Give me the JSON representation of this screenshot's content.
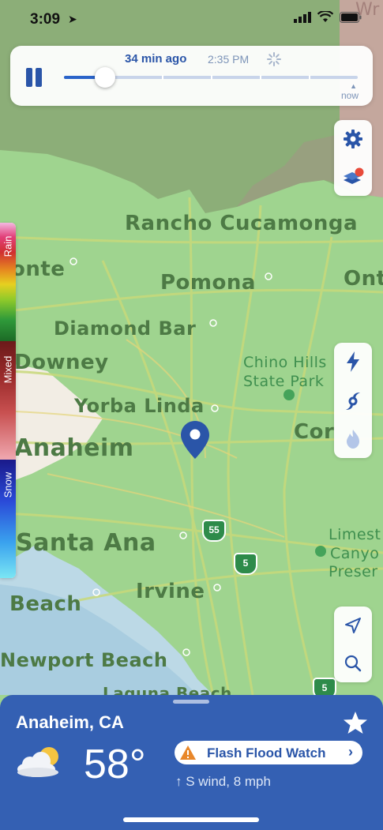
{
  "status_bar": {
    "time": "3:09",
    "location_arrow": "location-arrow-icon"
  },
  "timeline": {
    "time_ago": "34 min ago",
    "clock_time": "2:35 PM",
    "now_label": "now",
    "progress": 0.14
  },
  "legend": {
    "rain": "Rain",
    "mixed": "Mixed",
    "snow": "Snow"
  },
  "map_labels": {
    "rancho": "Rancho Cucamonga",
    "ontario_left": "onte",
    "pomona": "Pomona",
    "ontario_right": "Ont",
    "diamond_bar": "Diamond Bar",
    "downey": "Downey",
    "chino_hills_1": "Chino Hills",
    "chino_hills_2": "State Park",
    "yorba_linda": "Yorba Linda",
    "corona": "Cor",
    "anaheim": "Anaheim",
    "santa_ana": "Santa Ana",
    "limestone_1": "Limest",
    "limestone_2": "Canyo",
    "limestone_3": "Preser",
    "beach": "Beach",
    "irvine": "Irvine",
    "newport": "Newport Beach",
    "laguna": "Laguna Beach",
    "wr": "Wr",
    "shield_55": "55",
    "shield_5": "5",
    "shield_5b": "5"
  },
  "weather": {
    "city": "Anaheim, CA",
    "temperature": "58°",
    "alert": "Flash Flood Watch",
    "wind": "↑ S wind, 8 mph",
    "condition_icon": "partly-cloudy-icon"
  },
  "colors": {
    "accent": "#2a55a8",
    "panel": "#3460b3",
    "map_green": "#9fd48f",
    "map_rain_heavy": "#8cb57a",
    "map_mixed": "#b89c94"
  }
}
